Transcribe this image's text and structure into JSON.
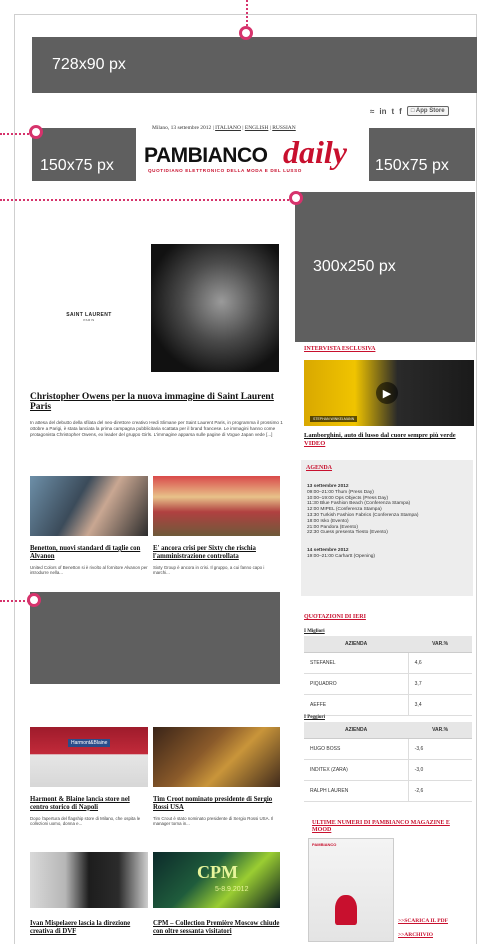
{
  "ads": {
    "leaderboard": "728x90 px",
    "left_small": "150x75 px",
    "right_small": "150x75 px",
    "mrec": "300x250 px"
  },
  "header": {
    "dateline_prefix": "Milano, 13 settembre 2012 |",
    "lang_it": "ITALIANO",
    "lang_en": "ENGLISH",
    "lang_ru": "RUSSIAN",
    "sep": "|",
    "logo_main": "PAMBIANCO",
    "logo_script": "daily",
    "tagline": "QUOTIDIANO ELETTRONICO DELLA MODA E DEL LUSSO",
    "social": [
      "rss",
      "in",
      "t",
      "f"
    ],
    "app_store": "App Store"
  },
  "main_story": {
    "brand": "SAINT LAURENT",
    "brand_sub": "PARIS",
    "title": "Christopher Owens per la nuova immagine di Saint Laurent Paris",
    "excerpt": "In attesa del debutto della sfilata del neo-direttore creativo Hedi Slimane per Saint Laurent Paris, in programma il prossimo 1 ottobre a Parigi, è stata lanciata la prima campagna pubblicitaria scattata per il brand francese. Le immagini hanno come protagonista Christopher Owens, ex leader del gruppo Girls. L'immagine apparsa sulle pagine di Vogue Japan vede [...]"
  },
  "stories_row1": [
    {
      "title": "Benetton, nuovi standard di taglie con Alvanon",
      "excerpt": "United Colors of Benetton si è rivolto al fornitore Alvanon per introdurre nella..."
    },
    {
      "title": "E' ancora crisi per Sixty che rischia l'amministrazione controllata",
      "excerpt": "Sixty Group è ancora in crisi. Il gruppo, a cui fanno capo i marchi..."
    }
  ],
  "stories_row2": [
    {
      "title": "Harmont & Blaine lancia store nel centro storico di Napoli",
      "excerpt": "Dopo l'apertura del flagship store di Milano, che ospita le collezioni uomo, donna e..."
    },
    {
      "title": "Tim Croot nominato presidente di Sergio Rossi USA",
      "excerpt": "Tim Crout è stato nominato presidente di Sergio Rossi USA. Il manager torna in..."
    }
  ],
  "stories_row3": [
    {
      "title": "Ivan Mispelaere lascia la direzione creativa di DVF",
      "excerpt": ""
    },
    {
      "title": "CPM – Collection Première Moscow chiude con oltre sessanta visitatori",
      "excerpt": ""
    }
  ],
  "thumb_text": {
    "hb_store": "Harmont&Blaine",
    "cpm": "CPM",
    "cpm_date": "5-8.9.2012"
  },
  "sidebar": {
    "interview_label": "INTERVISTA ESCLUSIVA",
    "video_caption": "STEPHAN WINKELMANN",
    "video_title": "Lamborghini, auto di lusso dal cuore sempre più verde",
    "video_link": "VIDEO",
    "agenda_label": "AGENDA",
    "agenda": [
      {
        "date": "13 settembre 2012",
        "items": [
          "09:00–21:00 Thum (Press Day)",
          "10:00–19:00 Ops Objects (Press Day)",
          "11:30 Blue Fashion Beach (Conferenza Stampa)",
          "12:00 MIPEL (Conferenza Stampa)",
          "13:30 Turkish Fashion Fabrics (Conferenza Stampa)",
          "18:00 Isko (Evento)",
          "21:00 Pandora (Evento)",
          "22:30 Guess presenta Tiesto (Evento)"
        ]
      },
      {
        "date": "14 settembre 2012",
        "items": [
          "19:00–21:00 Carhartt (Opening)"
        ]
      }
    ],
    "quotes_label": "QUOTAZIONI DI IERI",
    "best_label": "I Migliori",
    "worst_label": "I Peggiori",
    "col_company": "AZIENDA",
    "col_var": "VAR.%",
    "best": [
      [
        "STEFANEL",
        "4,6"
      ],
      [
        "PIQUADRO",
        "3,7"
      ],
      [
        "AEFFE",
        "3,4"
      ]
    ],
    "worst": [
      [
        "HUGO BOSS",
        "-3,6"
      ],
      [
        "INDITEX (ZARA)",
        "-3,0"
      ],
      [
        "RALPH LAUREN",
        "-2,6"
      ]
    ],
    "magazine_label": "ULTIME NUMERI DI PAMBIANCO MAGAZINE E MOOD",
    "mag_cover_title": "PAMBIANCO",
    "pdf_link": ">>SCARICA IL PDF",
    "archive_link": ">>ARCHIVIO"
  },
  "colors": {
    "accent": "#d6336c",
    "ad_gray": "#5f5f5f",
    "logo_red": "#c8102e"
  }
}
